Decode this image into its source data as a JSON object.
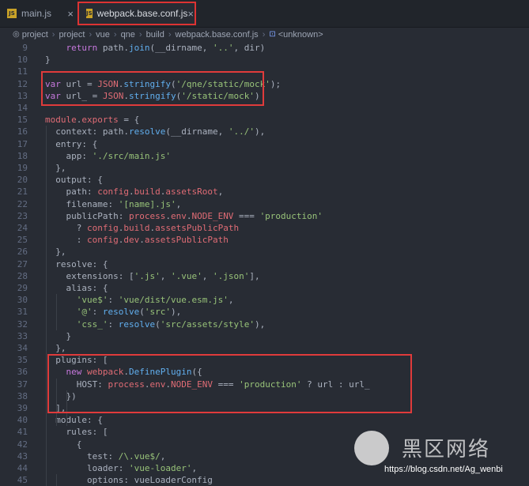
{
  "tabs": [
    {
      "label": "main.js",
      "badge": "JS",
      "close": "×",
      "active": false
    },
    {
      "label": "webpack.base.conf.js",
      "badge": "JS",
      "close": "×",
      "active": true
    }
  ],
  "breadcrumb": {
    "items": [
      "project",
      "project",
      "vue",
      "qne",
      "build",
      "webpack.base.conf.js",
      "<unknown>"
    ],
    "separator": "›"
  },
  "colors": {
    "background": "#282c34",
    "highlight_border": "#e03b3b",
    "keyword": "#c678dd",
    "function": "#61afef",
    "string": "#98c379",
    "variable": "#e06c75"
  },
  "lines": [
    {
      "n": "9",
      "tokens": [
        [
          "    ",
          "tok-plain"
        ],
        [
          "return ",
          "tok-kw"
        ],
        [
          "path",
          "tok-plain"
        ],
        [
          ".",
          "tok-plain"
        ],
        [
          "join",
          "tok-fn"
        ],
        [
          "(__dirname, ",
          "tok-plain"
        ],
        [
          "'..'",
          "tok-str"
        ],
        [
          ", dir)",
          "tok-plain"
        ]
      ]
    },
    {
      "n": "10",
      "tokens": [
        [
          "}",
          "tok-plain"
        ]
      ]
    },
    {
      "n": "11",
      "tokens": []
    },
    {
      "n": "12",
      "tokens": [
        [
          "var ",
          "tok-kw"
        ],
        [
          "url = ",
          "tok-plain"
        ],
        [
          "JSON",
          "tok-var"
        ],
        [
          ".",
          "tok-plain"
        ],
        [
          "stringify",
          "tok-fn"
        ],
        [
          "(",
          "tok-plain"
        ],
        [
          "'/qne/static/mock'",
          "tok-str"
        ],
        [
          ");",
          "tok-plain"
        ]
      ]
    },
    {
      "n": "13",
      "tokens": [
        [
          "var ",
          "tok-kw"
        ],
        [
          "url_ = ",
          "tok-plain"
        ],
        [
          "JSON",
          "tok-var"
        ],
        [
          ".",
          "tok-plain"
        ],
        [
          "stringify",
          "tok-fn"
        ],
        [
          "(",
          "tok-plain"
        ],
        [
          "'/static/mock'",
          "tok-str"
        ],
        [
          ")",
          "tok-plain"
        ]
      ]
    },
    {
      "n": "14",
      "tokens": []
    },
    {
      "n": "15",
      "tokens": [
        [
          "module",
          "tok-var"
        ],
        [
          ".",
          "tok-plain"
        ],
        [
          "exports",
          "tok-var"
        ],
        [
          " = {",
          "tok-plain"
        ]
      ]
    },
    {
      "n": "16",
      "tokens": [
        [
          "  context: ",
          "tok-plain"
        ],
        [
          "path",
          "tok-plain"
        ],
        [
          ".",
          "tok-plain"
        ],
        [
          "resolve",
          "tok-fn"
        ],
        [
          "(__dirname, ",
          "tok-plain"
        ],
        [
          "'../'",
          "tok-str"
        ],
        [
          "),",
          "tok-plain"
        ]
      ]
    },
    {
      "n": "17",
      "tokens": [
        [
          "  entry: {",
          "tok-plain"
        ]
      ]
    },
    {
      "n": "18",
      "tokens": [
        [
          "    app: ",
          "tok-plain"
        ],
        [
          "'./src/main.js'",
          "tok-str"
        ]
      ]
    },
    {
      "n": "19",
      "tokens": [
        [
          "  },",
          "tok-plain"
        ]
      ]
    },
    {
      "n": "20",
      "tokens": [
        [
          "  output: {",
          "tok-plain"
        ]
      ]
    },
    {
      "n": "21",
      "tokens": [
        [
          "    path: ",
          "tok-plain"
        ],
        [
          "config",
          "tok-var"
        ],
        [
          ".",
          "tok-plain"
        ],
        [
          "build",
          "tok-var"
        ],
        [
          ".",
          "tok-plain"
        ],
        [
          "assetsRoot",
          "tok-var"
        ],
        [
          ",",
          "tok-plain"
        ]
      ]
    },
    {
      "n": "22",
      "tokens": [
        [
          "    filename: ",
          "tok-plain"
        ],
        [
          "'[name].js'",
          "tok-str"
        ],
        [
          ",",
          "tok-plain"
        ]
      ]
    },
    {
      "n": "23",
      "tokens": [
        [
          "    publicPath: ",
          "tok-plain"
        ],
        [
          "process",
          "tok-var"
        ],
        [
          ".",
          "tok-plain"
        ],
        [
          "env",
          "tok-var"
        ],
        [
          ".",
          "tok-plain"
        ],
        [
          "NODE_ENV",
          "tok-var"
        ],
        [
          " === ",
          "tok-plain"
        ],
        [
          "'production'",
          "tok-str"
        ]
      ]
    },
    {
      "n": "24",
      "tokens": [
        [
          "      ? ",
          "tok-plain"
        ],
        [
          "config",
          "tok-var"
        ],
        [
          ".",
          "tok-plain"
        ],
        [
          "build",
          "tok-var"
        ],
        [
          ".",
          "tok-plain"
        ],
        [
          "assetsPublicPath",
          "tok-var"
        ]
      ]
    },
    {
      "n": "25",
      "tokens": [
        [
          "      : ",
          "tok-plain"
        ],
        [
          "config",
          "tok-var"
        ],
        [
          ".",
          "tok-plain"
        ],
        [
          "dev",
          "tok-var"
        ],
        [
          ".",
          "tok-plain"
        ],
        [
          "assetsPublicPath",
          "tok-var"
        ]
      ]
    },
    {
      "n": "26",
      "tokens": [
        [
          "  },",
          "tok-plain"
        ]
      ]
    },
    {
      "n": "27",
      "tokens": [
        [
          "  resolve: {",
          "tok-plain"
        ]
      ]
    },
    {
      "n": "28",
      "tokens": [
        [
          "    extensions: [",
          "tok-plain"
        ],
        [
          "'.js'",
          "tok-str"
        ],
        [
          ", ",
          "tok-plain"
        ],
        [
          "'.vue'",
          "tok-str"
        ],
        [
          ", ",
          "tok-plain"
        ],
        [
          "'.json'",
          "tok-str"
        ],
        [
          "],",
          "tok-plain"
        ]
      ]
    },
    {
      "n": "29",
      "tokens": [
        [
          "    alias: {",
          "tok-plain"
        ]
      ]
    },
    {
      "n": "30",
      "tokens": [
        [
          "      ",
          "tok-plain"
        ],
        [
          "'vue$'",
          "tok-str"
        ],
        [
          ": ",
          "tok-plain"
        ],
        [
          "'vue/dist/vue.esm.js'",
          "tok-str"
        ],
        [
          ",",
          "tok-plain"
        ]
      ]
    },
    {
      "n": "31",
      "tokens": [
        [
          "      ",
          "tok-plain"
        ],
        [
          "'@'",
          "tok-str"
        ],
        [
          ": ",
          "tok-plain"
        ],
        [
          "resolve",
          "tok-fn"
        ],
        [
          "(",
          "tok-plain"
        ],
        [
          "'src'",
          "tok-str"
        ],
        [
          "),",
          "tok-plain"
        ]
      ]
    },
    {
      "n": "32",
      "tokens": [
        [
          "      ",
          "tok-plain"
        ],
        [
          "'css_'",
          "tok-str"
        ],
        [
          ": ",
          "tok-plain"
        ],
        [
          "resolve",
          "tok-fn"
        ],
        [
          "(",
          "tok-plain"
        ],
        [
          "'src/assets/style'",
          "tok-str"
        ],
        [
          "),",
          "tok-plain"
        ]
      ]
    },
    {
      "n": "33",
      "tokens": [
        [
          "    }",
          "tok-plain"
        ]
      ]
    },
    {
      "n": "34",
      "tokens": [
        [
          "  },",
          "tok-plain"
        ]
      ]
    },
    {
      "n": "35",
      "tokens": [
        [
          "  plugins: [",
          "tok-plain"
        ]
      ]
    },
    {
      "n": "36",
      "tokens": [
        [
          "    ",
          "tok-plain"
        ],
        [
          "new ",
          "tok-kw"
        ],
        [
          "webpack",
          "tok-var"
        ],
        [
          ".",
          "tok-plain"
        ],
        [
          "DefinePlugin",
          "tok-fn"
        ],
        [
          "({",
          "tok-plain"
        ]
      ]
    },
    {
      "n": "37",
      "tokens": [
        [
          "      HOST: ",
          "tok-plain"
        ],
        [
          "process",
          "tok-var"
        ],
        [
          ".",
          "tok-plain"
        ],
        [
          "env",
          "tok-var"
        ],
        [
          ".",
          "tok-plain"
        ],
        [
          "NODE_ENV",
          "tok-var"
        ],
        [
          " === ",
          "tok-plain"
        ],
        [
          "'production'",
          "tok-str"
        ],
        [
          " ? url : url_",
          "tok-plain"
        ]
      ]
    },
    {
      "n": "38",
      "tokens": [
        [
          "    })",
          "tok-plain"
        ]
      ]
    },
    {
      "n": "39",
      "tokens": [
        [
          "  ],",
          "tok-plain"
        ]
      ]
    },
    {
      "n": "40",
      "tokens": [
        [
          "  module: {",
          "tok-plain"
        ]
      ]
    },
    {
      "n": "41",
      "tokens": [
        [
          "    rules: [",
          "tok-plain"
        ]
      ]
    },
    {
      "n": "42",
      "tokens": [
        [
          "      {",
          "tok-plain"
        ]
      ]
    },
    {
      "n": "43",
      "tokens": [
        [
          "        test: ",
          "tok-plain"
        ],
        [
          "/\\.vue$/",
          "tok-str"
        ],
        [
          ",",
          "tok-plain"
        ]
      ]
    },
    {
      "n": "44",
      "tokens": [
        [
          "        loader: ",
          "tok-plain"
        ],
        [
          "'vue-loader'",
          "tok-str"
        ],
        [
          ",",
          "tok-plain"
        ]
      ]
    },
    {
      "n": "45",
      "tokens": [
        [
          "        options: vueLoaderConfig",
          "tok-plain"
        ]
      ]
    }
  ],
  "watermark": {
    "text": "https://blog.csdn.net/Ag_wenbi",
    "logo": "黑区网络"
  }
}
